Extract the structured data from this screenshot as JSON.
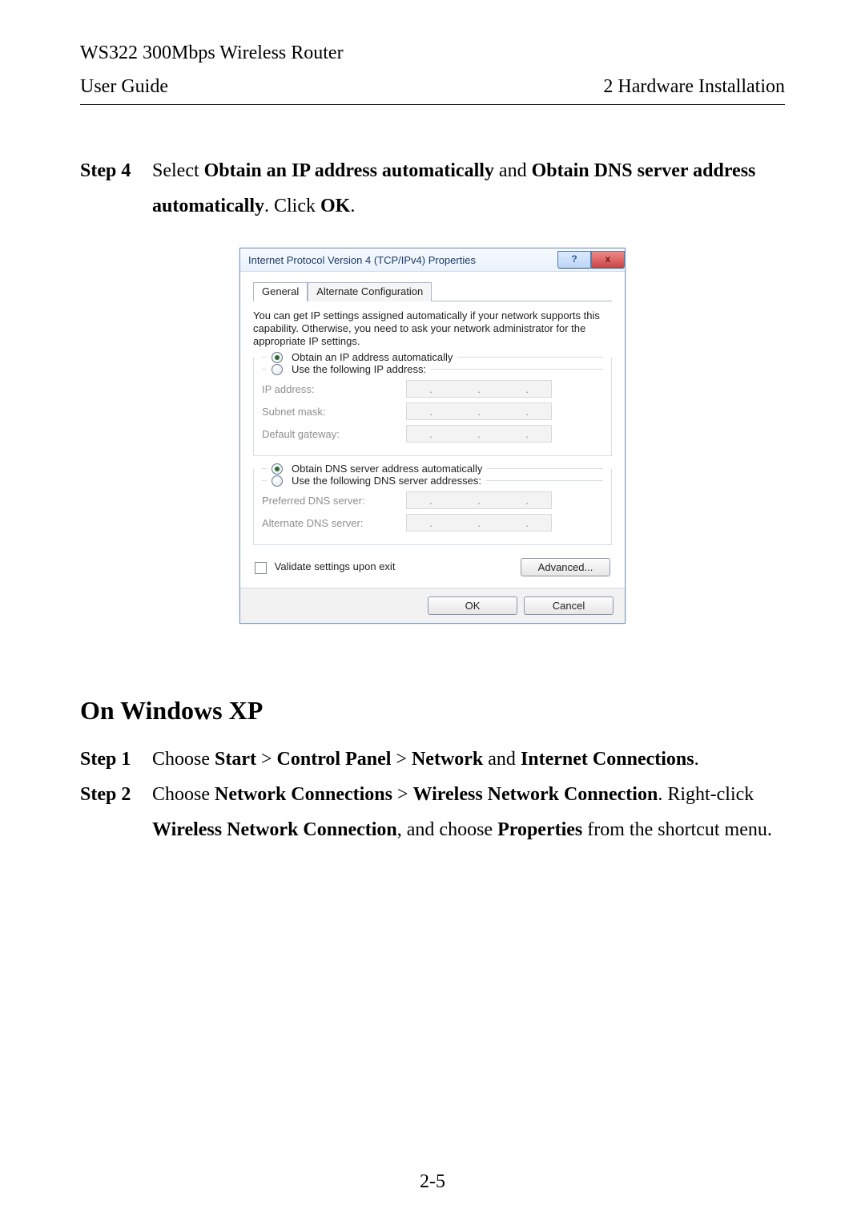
{
  "header": {
    "product": "WS322 300Mbps Wireless Router",
    "left": "User Guide",
    "right": "2 Hardware Installation"
  },
  "step4": {
    "label": "Step 4",
    "pre": "Select ",
    "b1": "Obtain an IP address automatically",
    "mid1": " and ",
    "b2": "Obtain DNS server address automatically",
    "mid2": ". Click ",
    "b3": "OK",
    "end": "."
  },
  "dialog": {
    "title": "Internet Protocol Version 4 (TCP/IPv4) Properties",
    "help": "?",
    "close": "x",
    "tabs": {
      "general": "General",
      "alt": "Alternate Configuration"
    },
    "info": "You can get IP settings assigned automatically if your network supports this capability. Otherwise, you need to ask your network administrator for the appropriate IP settings.",
    "ip": {
      "auto": "Obtain an IP address automatically",
      "manual": "Use the following IP address:",
      "addr": "IP address:",
      "mask": "Subnet mask:",
      "gw": "Default gateway:"
    },
    "dns": {
      "auto": "Obtain DNS server address automatically",
      "manual": "Use the following DNS server addresses:",
      "pref": "Preferred DNS server:",
      "alt": "Alternate DNS server:"
    },
    "validate": "Validate settings upon exit",
    "advanced": "Advanced...",
    "ok": "OK",
    "cancel": "Cancel"
  },
  "xp": {
    "heading": "On Windows XP",
    "s1": {
      "label": "Step 1",
      "t1": "Choose ",
      "b1": "Start",
      "gt1": " > ",
      "b2": "Control Panel",
      "gt2": " > ",
      "b3": "Network",
      "t2": " and ",
      "b4": "Internet Connections",
      "end": "."
    },
    "s2": {
      "label": "Step 2",
      "t1": "Choose ",
      "b1": "Network Connections",
      "gt1": " > ",
      "b2": "Wireless Network Connection",
      "end1": ". ",
      "t2a": "Right-click ",
      "b3": "Wireless Network Connection",
      "t2b": ", and choose ",
      "b4": "Properties",
      "t3": " from the shortcut menu."
    }
  },
  "page_number": "2-5"
}
